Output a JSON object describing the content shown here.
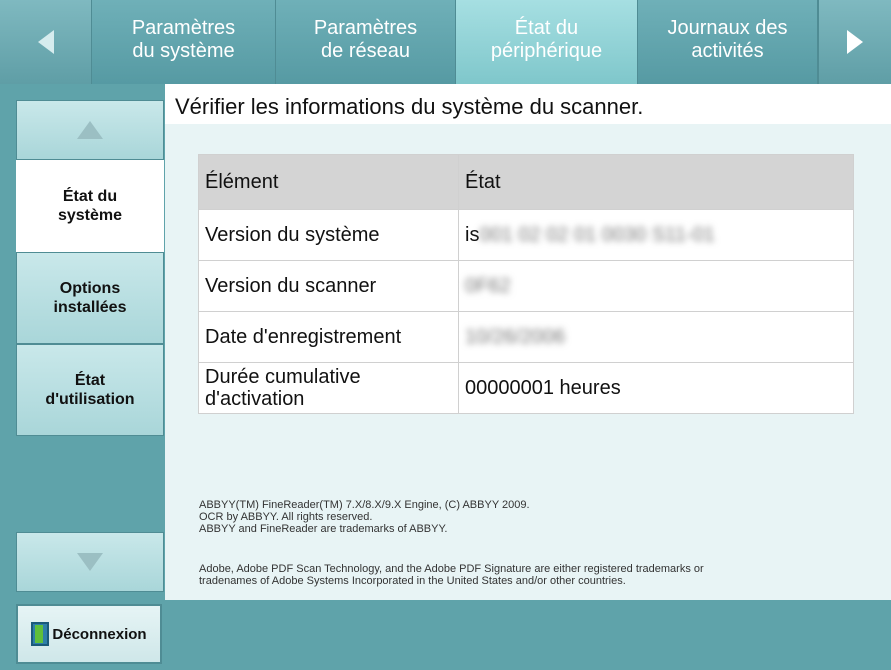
{
  "tabs": [
    {
      "label": "Paramètres\ndu système",
      "active": false
    },
    {
      "label": "Paramètres\nde réseau",
      "active": false
    },
    {
      "label": "État du\npériphérique",
      "active": true
    },
    {
      "label": "Journaux des\nactivités",
      "active": false
    }
  ],
  "sidebar": {
    "items": [
      {
        "label": "État du\nsystème",
        "active": true
      },
      {
        "label": "Options\ninstallées",
        "active": false
      },
      {
        "label": "État\nd'utilisation",
        "active": false
      }
    ]
  },
  "main": {
    "heading": "Vérifier les informations du système du scanner.",
    "table": {
      "headers": [
        "Élément",
        "État"
      ],
      "rows": [
        {
          "item": "Version du système",
          "value_prefix": "is",
          "value_blurred": "001 02 02 01 0030 S11-01"
        },
        {
          "item": "Version du scanner",
          "value_blurred": "0F62"
        },
        {
          "item": "Date d'enregistrement",
          "value_blurred": "10/26/2006"
        },
        {
          "item": "Durée cumulative\nd'activation",
          "value": "00000001 heures"
        }
      ]
    },
    "notices": [
      "ABBYY(TM) FineReader(TM) 7.X/8.X/9.X Engine, (C) ABBYY 2009.",
      "OCR by ABBYY. All rights reserved.",
      "ABBYY and FineReader are trademarks of ABBYY.",
      "Adobe, Adobe PDF Scan Technology, and the Adobe PDF Signature are either registered trademarks or",
      "tradenames of Adobe Systems Incorporated in the United States and/or other countries."
    ]
  },
  "logout": {
    "label": "Déconnexion"
  }
}
